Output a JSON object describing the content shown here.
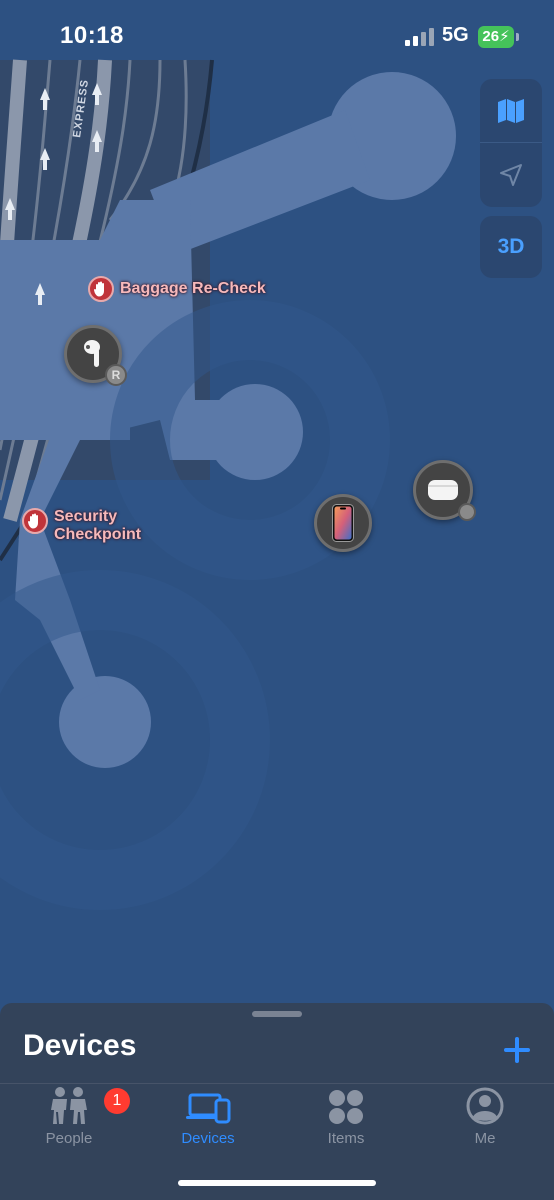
{
  "status_bar": {
    "time": "10:18",
    "network": "5G",
    "battery": "26"
  },
  "map": {
    "road_label": "EXPRESS",
    "three_d_label": "3D",
    "points_of_interest": [
      {
        "label": "Baggage Re-Check"
      },
      {
        "label": "Security Checkpoint",
        "lines": [
          "Security",
          "Checkpoint"
        ]
      }
    ],
    "pins": [
      {
        "device": "AirPod",
        "badge": "R"
      },
      {
        "device": "iPhone"
      },
      {
        "device": "AirPods case"
      }
    ]
  },
  "sheet": {
    "title": "Devices"
  },
  "tabs": [
    {
      "label": "People",
      "badge": "1"
    },
    {
      "label": "Devices",
      "active": true
    },
    {
      "label": "Items"
    },
    {
      "label": "Me"
    }
  ],
  "colors": {
    "accent": "#2f8cff",
    "map_water": "#2d5182",
    "map_building": "#5b79a8",
    "poi": "#c0343a"
  }
}
